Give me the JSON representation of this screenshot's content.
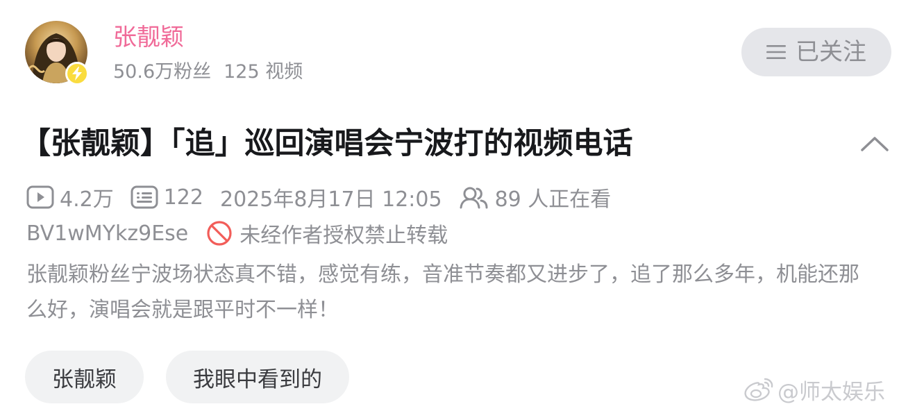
{
  "uploader": {
    "name": "张靓颖",
    "followers": "50.6万粉丝",
    "videos": "125 视频",
    "follow_button_label": "已关注",
    "badge_icon": "lightning-icon"
  },
  "video": {
    "title": "【张靓颖】「追」巡回演唱会宁波打的视频电话",
    "views": "4.2万",
    "danmaku": "122",
    "publish_time": "2025年8月17日 12:05",
    "watching": "89 人正在看",
    "bvid": "BV1wMYkz9Ese",
    "copyright_notice": "未经作者授权禁止转载",
    "description": "张靓颖粉丝宁波场状态真不错，感觉有练，音准节奏都又进步了，追了那么多年，机能还那么好，演唱会就是跟平时不一样！"
  },
  "tags": [
    "张靓颖",
    "我眼中看到的"
  ],
  "watermark": "@师太娱乐",
  "colors": {
    "uploader_name": "#f06a98",
    "secondary_text": "#8e8f94",
    "title_text": "#18191c",
    "follow_button_bg": "#e5e6ea",
    "tag_bg": "#f1f2f3",
    "badge_yellow": "#fadc3f",
    "prohibit_red": "#f25d59"
  }
}
